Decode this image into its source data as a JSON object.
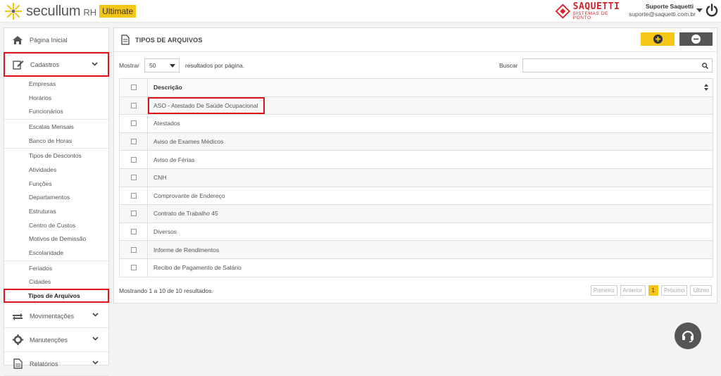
{
  "header": {
    "logo_text": "secullum",
    "logo_rh": "RH",
    "logo_badge": "Ultimate",
    "partner_name": "SAQUETTI",
    "partner_sub": "SISTEMAS DE PONTO",
    "user_name": "Suporte Saquetti",
    "user_email": "suporte@saquetti.com.br"
  },
  "sidebar": {
    "home": "Página Inicial",
    "cadastros": "Cadastros",
    "groups": [
      [
        "Empresas",
        "Horários",
        "Funcionários"
      ],
      [
        "Escalas Mensais",
        "Banco de Horas"
      ],
      [
        "Tipos de Descontos",
        "Atividades",
        "Funções",
        "Departamentos",
        "Estruturas",
        "Centro de Custos",
        "Motivos de Demissão",
        "Escolaridade"
      ],
      [
        "Feriados",
        "Cidades",
        "Tipos de Arquivos"
      ]
    ],
    "movimentacoes": "Movimentações",
    "manutencoes": "Manutenções",
    "relatorios": "Relatórios"
  },
  "panel": {
    "title": "TIPOS DE ARQUIVOS",
    "show_label": "Mostrar",
    "page_size": "50",
    "per_page_label": "resultados por página.",
    "search_label": "Buscar",
    "column_header": "Descrição",
    "rows": [
      "ASO - Atestado De Saúde Ocupacional",
      "Atestados",
      "Aviso de Exames Médicos",
      "Aviso de Férias",
      "CNH",
      "Comprovante de Endereço",
      "Contrato de Trabalho 45",
      "Diversos",
      "Informe de Rendimentos",
      "Recibo de Pagamento de Salário"
    ],
    "footer_info": "Mostrando 1 a 10 de 10 resultados.",
    "pager": {
      "first": "Primeiro",
      "prev": "Anterior",
      "current": "1",
      "next": "Próximo",
      "last": "Último"
    }
  },
  "colors": {
    "accent": "#f5c518",
    "highlight_red": "#e0111b",
    "dark_button": "#555555"
  }
}
